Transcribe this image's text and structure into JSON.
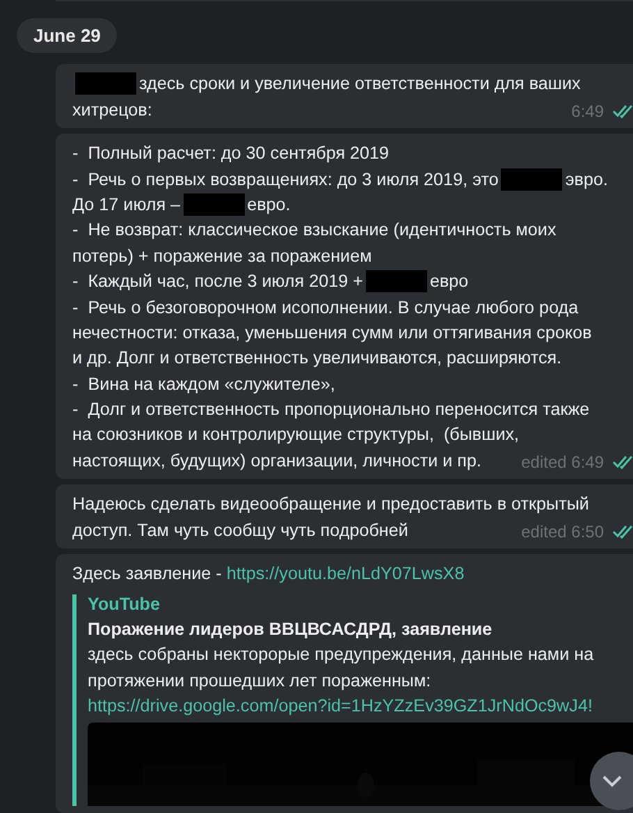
{
  "date_pill": "June 29",
  "messages": [
    {
      "lines": [
        [
          {
            "kind": "redacted"
          },
          {
            "kind": "text",
            "text": "здесь сроки и увеличение ответственности для ваших"
          }
        ],
        [
          {
            "kind": "text",
            "text": "хитрецов:"
          }
        ]
      ],
      "time": "6:49",
      "read": true
    },
    {
      "lines": [
        [
          {
            "kind": "text",
            "text": "-  Полный расчет: до 30 сентября 2019"
          }
        ],
        [
          {
            "kind": "text",
            "text": "-  Речь о первых возвращениях: до 3 июля 2019, это"
          },
          {
            "kind": "redacted"
          },
          {
            "kind": "text",
            "text": "эвро."
          }
        ],
        [
          {
            "kind": "text",
            "text": "До 17 июля –"
          },
          {
            "kind": "redacted"
          },
          {
            "kind": "text",
            "text": "евро."
          }
        ],
        [
          {
            "kind": "text",
            "text": "-  Не возврат: классическое взыскание (идентичность моих"
          }
        ],
        [
          {
            "kind": "text",
            "text": "потерь) + поражение за поражением"
          }
        ],
        [
          {
            "kind": "text",
            "text": "-  Каждый час, после 3 июля 2019 +"
          },
          {
            "kind": "redacted"
          },
          {
            "kind": "text",
            "text": "евро"
          }
        ],
        [
          {
            "kind": "text",
            "text": "-  Речь о безоговорочном исополнении. В случае любого рода"
          }
        ],
        [
          {
            "kind": "text",
            "text": "нечестности: отказа, уменьшения сумм или оттягивания сроков"
          }
        ],
        [
          {
            "kind": "text",
            "text": "и др. Долг и ответственность увеличиваются, расширяются."
          }
        ],
        [
          {
            "kind": "text",
            "text": "-  Вина на каждом «служителе»,"
          }
        ],
        [
          {
            "kind": "text",
            "text": "-  Долг и ответственность пропорционально переносится также"
          }
        ],
        [
          {
            "kind": "text",
            "text": "на союзников и контролирующие структуры,  (бывших,"
          }
        ],
        [
          {
            "kind": "text",
            "text": "настоящих, будущих) организации, личности и пр."
          }
        ]
      ],
      "time": "edited 6:49",
      "read": true
    },
    {
      "lines": [
        [
          {
            "kind": "text",
            "text": "Надеюсь сделать видеообращение и предоставить в открытый"
          }
        ],
        [
          {
            "kind": "text",
            "text": "доступ. Там чуть сообщу чуть подробней"
          }
        ]
      ],
      "time": "edited 6:50",
      "read": true
    },
    {
      "lines": [
        [
          {
            "kind": "text",
            "text": "Здесь заявление - "
          },
          {
            "kind": "link",
            "text": "https://youtu.be/nLdY07LwsX8"
          }
        ]
      ],
      "preview": {
        "site": "YouTube",
        "title": "Поражение лидеров ВВЦВСАСДРД, заявление",
        "description": [
          "здесь собраны некторорые предупреждения, данные нами на",
          "протяжении прошедших лет пораженным:"
        ],
        "link": "https://drive.google.com/open?id=1HzYZzEv39GZ1JrNdOc9wJ4!",
        "media": {
          "kind": "picture"
        }
      }
    }
  ]
}
